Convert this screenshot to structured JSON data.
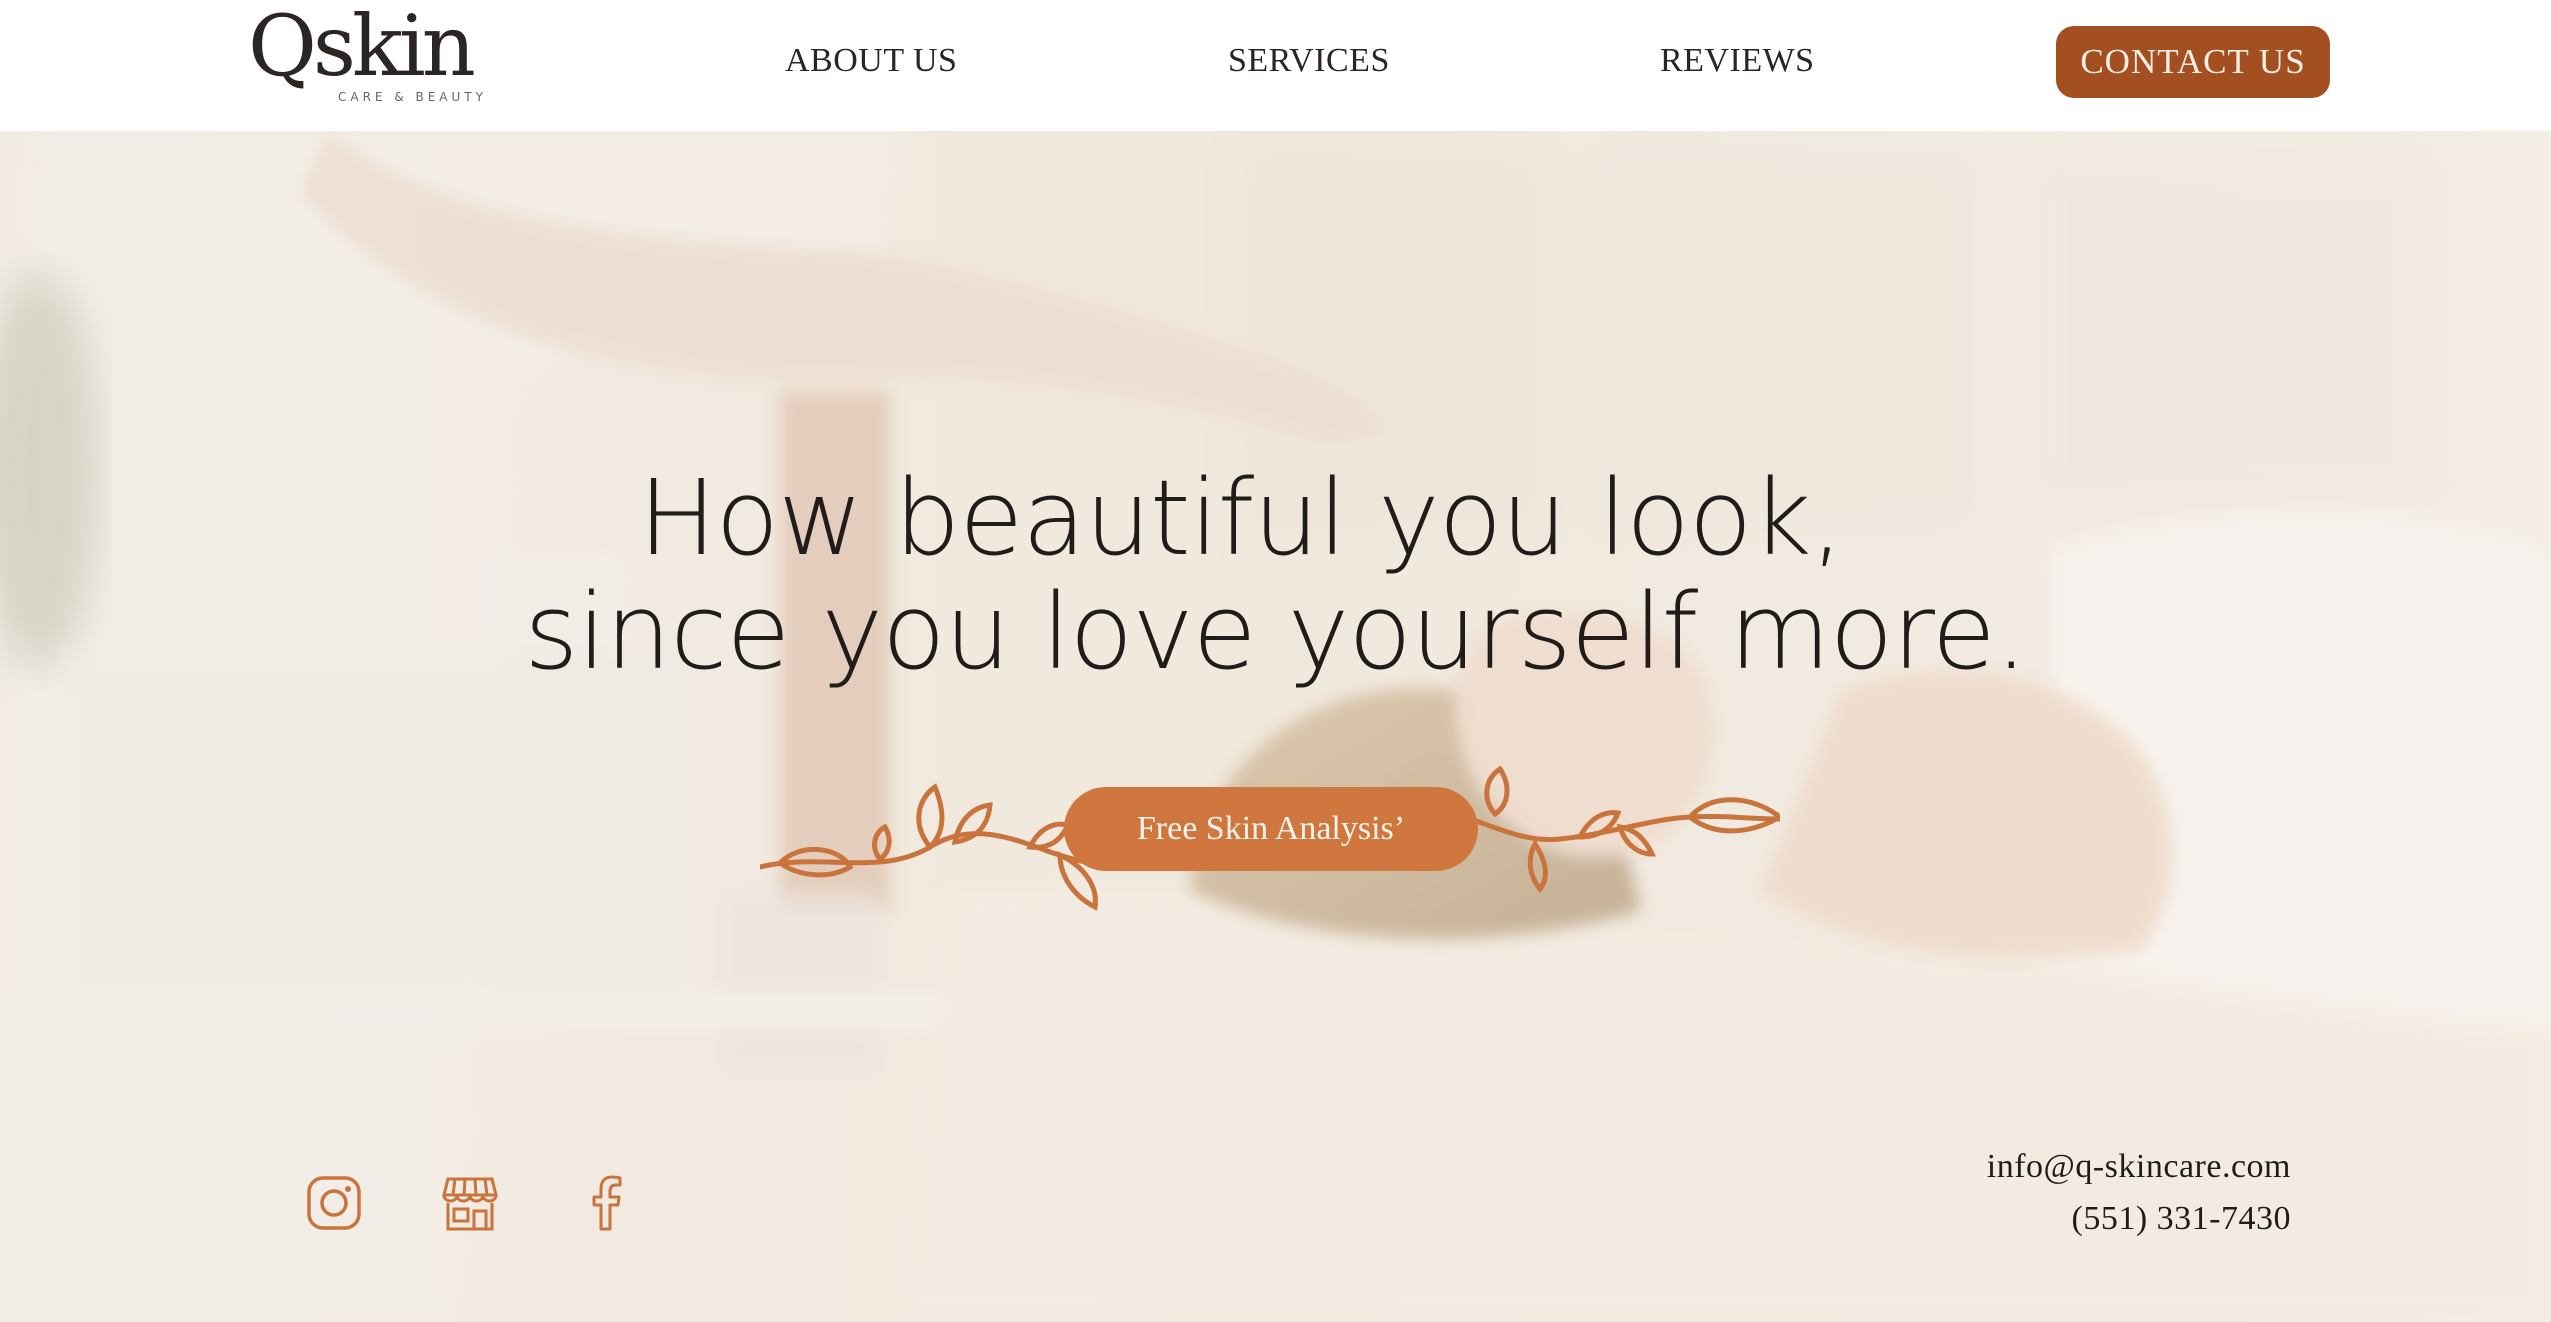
{
  "header": {
    "logo_text": "Qskin",
    "logo_tagline": "CARE & BEAUTY",
    "nav": [
      {
        "label": "ABOUT US"
      },
      {
        "label": "SERVICES"
      },
      {
        "label": "REVIEWS"
      }
    ],
    "contact_button": "CONTACT US"
  },
  "hero": {
    "headline_line1": "How beautiful you look,",
    "headline_line2": "since you love yourself more.",
    "cta_label": "Free Skin Analysis’"
  },
  "footer": {
    "social_icons": [
      "instagram-icon",
      "store-icon",
      "facebook-icon"
    ],
    "email": "info@q-skincare.com",
    "phone": "(551) 331-7430"
  },
  "colors": {
    "accent": "#a34f22",
    "cta": "#d0773f",
    "icon": "#c9733d",
    "text": "#1f1c1a"
  }
}
